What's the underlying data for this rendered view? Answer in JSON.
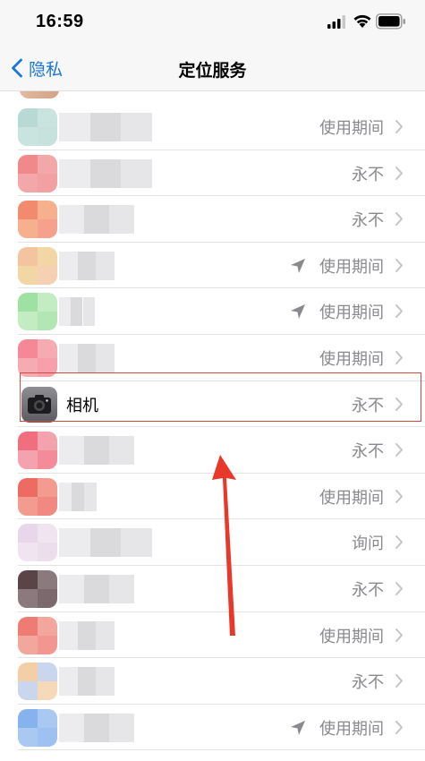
{
  "status": {
    "time": "16:59"
  },
  "nav": {
    "back_label": "隐私",
    "title": "定位服务"
  },
  "rows": [
    {
      "value": "使用期间",
      "location_arrow": false,
      "colors": [
        "#b9d9d4",
        "#c9e3df"
      ]
    },
    {
      "value": "永不",
      "location_arrow": false,
      "colors": [
        "#f0888c",
        "#f4a7a8"
      ]
    },
    {
      "value": "永不",
      "location_arrow": false,
      "colors": [
        "#f28a6e",
        "#f6b08e"
      ]
    },
    {
      "value": "使用期间",
      "location_arrow": true,
      "colors": [
        "#f4c4a0",
        "#f2d6a6"
      ]
    },
    {
      "value": "使用期间",
      "location_arrow": true,
      "colors": [
        "#9fe0a3",
        "#c3ecc2"
      ]
    },
    {
      "value": "使用期间",
      "location_arrow": false,
      "colors": [
        "#f58796",
        "#f6aab2"
      ]
    },
    {
      "name": "相机",
      "value": "永不",
      "location_arrow": false,
      "highlighted": true
    },
    {
      "value": "永不",
      "location_arrow": false,
      "colors": [
        "#f06e7e",
        "#f4a2ad"
      ]
    },
    {
      "value": "使用期间",
      "location_arrow": false,
      "colors": [
        "#ee6b63",
        "#f29b8e"
      ]
    },
    {
      "value": "询问",
      "location_arrow": false,
      "colors": [
        "#e8d6ea",
        "#f0e4f0"
      ]
    },
    {
      "value": "永不",
      "location_arrow": false,
      "colors": [
        "#5b4448",
        "#8a7a7e"
      ]
    },
    {
      "value": "使用期间",
      "location_arrow": false,
      "colors": [
        "#ee7c74",
        "#f3a69c"
      ]
    },
    {
      "value": "永不",
      "location_arrow": false,
      "colors": [
        "#f2cfa6",
        "#c9d6ee"
      ]
    },
    {
      "value": "使用期间",
      "location_arrow": true,
      "colors": [
        "#86b2ee",
        "#a9c8f2"
      ]
    }
  ],
  "annotation": {
    "highlight_color": "#d24a3e",
    "arrow_color": "#e8382a"
  },
  "colors": {
    "accent": "#1a76d9",
    "value_text": "#8a8a8e"
  }
}
